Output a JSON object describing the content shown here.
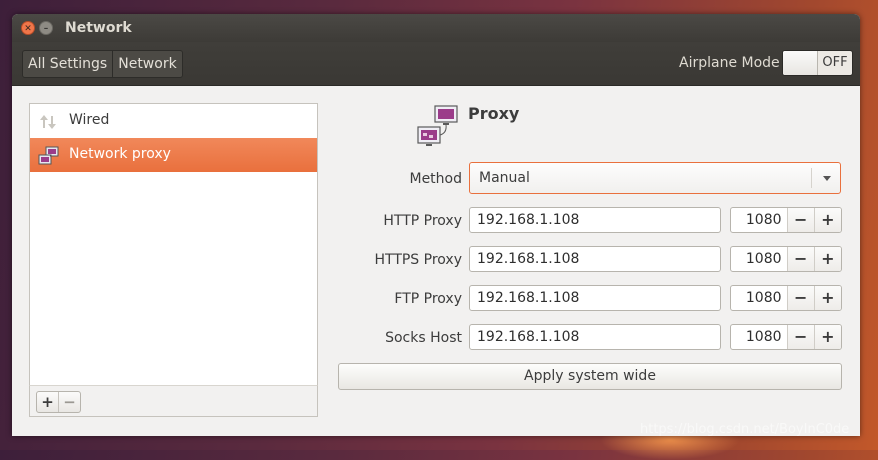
{
  "window": {
    "title": "Network"
  },
  "toolbar": {
    "crumbs": [
      "All Settings",
      "Network"
    ],
    "airplane_label": "Airplane Mode",
    "airplane_state": "OFF"
  },
  "sidebar": {
    "items": [
      {
        "label": "Wired",
        "icon": "network-wired-icon",
        "selected": false
      },
      {
        "label": "Network proxy",
        "icon": "network-proxy-icon",
        "selected": true
      }
    ],
    "add_label": "+",
    "remove_label": "−"
  },
  "proxy": {
    "heading": "Proxy",
    "method_label": "Method",
    "method_value": "Manual",
    "rows": [
      {
        "label": "HTTP Proxy",
        "host": "192.168.1.108",
        "port": "1080"
      },
      {
        "label": "HTTPS Proxy",
        "host": "192.168.1.108",
        "port": "1080"
      },
      {
        "label": "FTP Proxy",
        "host": "192.168.1.108",
        "port": "1080"
      },
      {
        "label": "Socks Host",
        "host": "192.168.1.108",
        "port": "1080"
      }
    ],
    "minus": "−",
    "plus": "+",
    "apply_label": "Apply system wide"
  },
  "watermark": "https://blog.csdn.net/BoyInC0de",
  "colors": {
    "accent": "#e9703d",
    "titlebar": "#3d3b37"
  }
}
